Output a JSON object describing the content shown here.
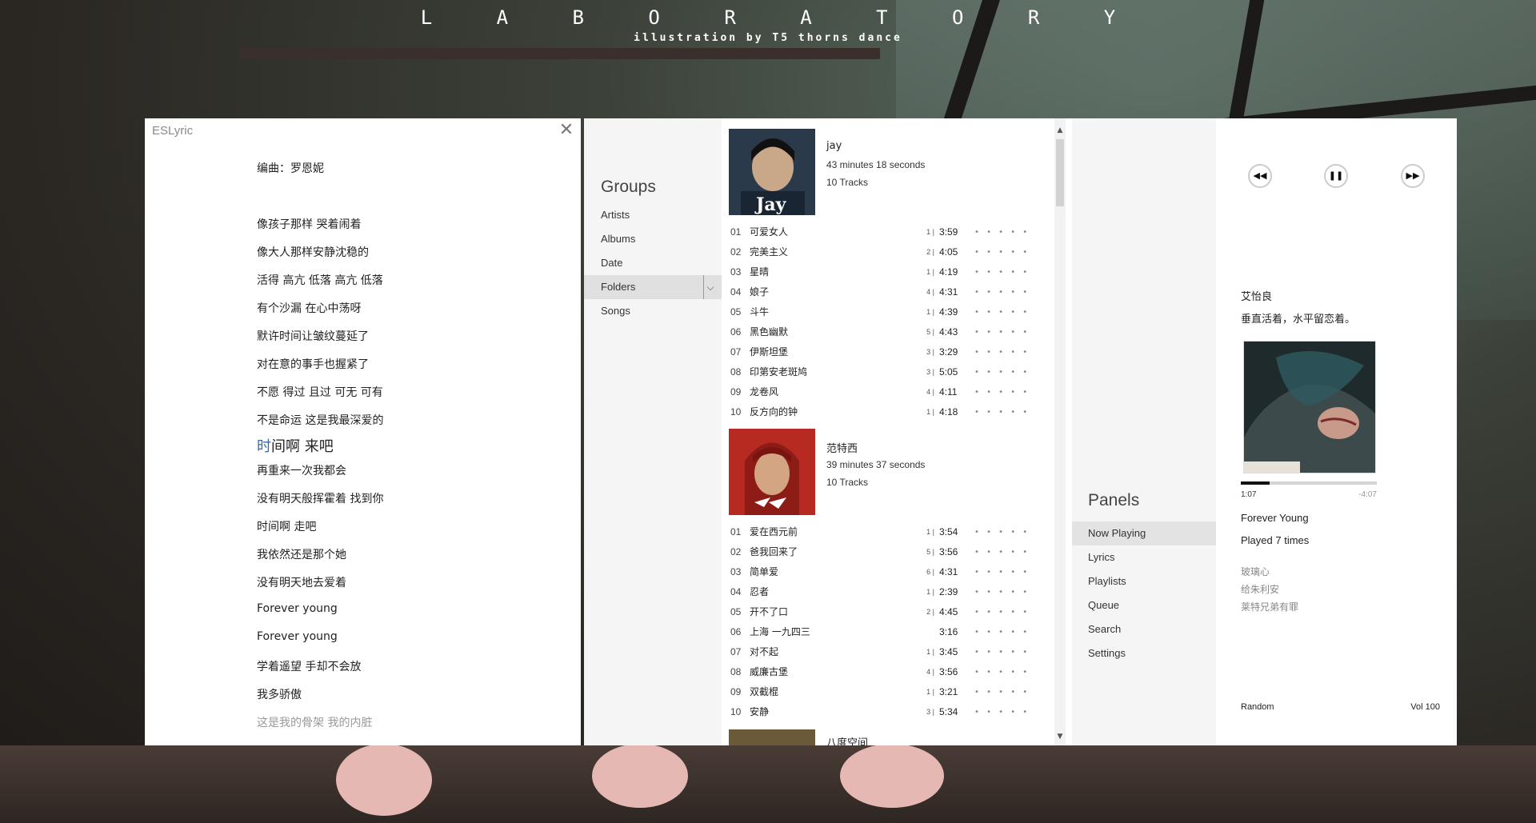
{
  "wallpaper": {
    "title": "L A B O R A T O R Y",
    "subtitle": "illustration by T5 thorns dance"
  },
  "eslyric": {
    "window_title": "ESLyric",
    "close_icon": "close-icon",
    "lines": [
      {
        "text": "编曲：罗恩妮",
        "state": "dim"
      },
      {
        "text": "像孩子那样 哭着闹着",
        "state": "normal"
      },
      {
        "text": "像大人那样安静沈稳的",
        "state": "normal"
      },
      {
        "text": "活得 高亢 低落 高亢 低落",
        "state": "normal"
      },
      {
        "text": "有个沙漏 在心中荡呀",
        "state": "normal"
      },
      {
        "text": "默许时间让皱纹蔓延了",
        "state": "normal"
      },
      {
        "text": "对在意的事手也握紧了",
        "state": "normal"
      },
      {
        "text": "不愿 得过 且过 可无 可有",
        "state": "normal"
      },
      {
        "text": "不是命运 这是我最深爱的",
        "state": "normal"
      },
      {
        "text": "时间啊 来吧",
        "state": "current",
        "highlight": "时",
        "rest": "间啊 来吧"
      },
      {
        "text": "再重来一次我都会",
        "state": "normal"
      },
      {
        "text": "没有明天般挥霍着 找到你",
        "state": "normal"
      },
      {
        "text": "时间啊 走吧",
        "state": "normal"
      },
      {
        "text": "我依然还是那个她",
        "state": "normal"
      },
      {
        "text": "没有明天地去爱着",
        "state": "normal"
      },
      {
        "text": "Forever young",
        "state": "normal"
      },
      {
        "text": "Forever young",
        "state": "normal"
      },
      {
        "text": "学着遥望 手却不会放",
        "state": "normal"
      },
      {
        "text": "我多骄傲",
        "state": "normal"
      },
      {
        "text": "这是我的骨架 我的内脏",
        "state": "dim"
      }
    ]
  },
  "groups": {
    "heading": "Groups",
    "items": [
      {
        "label": "Artists",
        "selected": false
      },
      {
        "label": "Albums",
        "selected": false
      },
      {
        "label": "Date",
        "selected": false
      },
      {
        "label": "Folders",
        "selected": true
      },
      {
        "label": "Songs",
        "selected": false
      }
    ],
    "dropdown_icon": "chevron-down-icon"
  },
  "albums": [
    {
      "name": "jay",
      "duration": "43 minutes 18 seconds",
      "track_count": "10 Tracks",
      "cover_text": "Jay",
      "tracks": [
        {
          "no": "01",
          "title": "可爱女人",
          "disc": "1 |",
          "length": "3:59"
        },
        {
          "no": "02",
          "title": "完美主义",
          "disc": "2 |",
          "length": "4:05"
        },
        {
          "no": "03",
          "title": "星晴",
          "disc": "1 |",
          "length": "4:19"
        },
        {
          "no": "04",
          "title": "娘子",
          "disc": "4 |",
          "length": "4:31"
        },
        {
          "no": "05",
          "title": "斗牛",
          "disc": "1 |",
          "length": "4:39"
        },
        {
          "no": "06",
          "title": "黑色幽默",
          "disc": "5 |",
          "length": "4:43"
        },
        {
          "no": "07",
          "title": "伊斯坦堡",
          "disc": "3 |",
          "length": "3:29"
        },
        {
          "no": "08",
          "title": "印第安老斑鸠",
          "disc": "3 |",
          "length": "5:05"
        },
        {
          "no": "09",
          "title": "龙卷风",
          "disc": "4 |",
          "length": "4:11"
        },
        {
          "no": "10",
          "title": "反方向的钟",
          "disc": "1 |",
          "length": "4:18"
        }
      ]
    },
    {
      "name": "范特西",
      "duration": "39 minutes 37 seconds",
      "track_count": "10 Tracks",
      "cover_text": "",
      "tracks": [
        {
          "no": "01",
          "title": "爱在西元前",
          "disc": "1 |",
          "length": "3:54"
        },
        {
          "no": "02",
          "title": "爸我回来了",
          "disc": "5 |",
          "length": "3:56"
        },
        {
          "no": "03",
          "title": "简单爱",
          "disc": "6 |",
          "length": "4:31"
        },
        {
          "no": "04",
          "title": "忍者",
          "disc": "1 |",
          "length": "2:39"
        },
        {
          "no": "05",
          "title": "开不了口",
          "disc": "2 |",
          "length": "4:45"
        },
        {
          "no": "06",
          "title": "上海 一九四三",
          "disc": "",
          "length": "3:16"
        },
        {
          "no": "07",
          "title": "对不起",
          "disc": "1 |",
          "length": "3:45"
        },
        {
          "no": "08",
          "title": "威廉古堡",
          "disc": "4 |",
          "length": "3:56"
        },
        {
          "no": "09",
          "title": "双截棍",
          "disc": "1 |",
          "length": "3:21"
        },
        {
          "no": "10",
          "title": "安静",
          "disc": "3 |",
          "length": "5:34"
        }
      ]
    },
    {
      "name": "八度空间",
      "duration": "",
      "track_count": "",
      "cover_text": "",
      "tracks": []
    }
  ],
  "rating_dots": "• • • • •",
  "scrollbar": {
    "up": "▲",
    "down": "▼"
  },
  "panels": {
    "heading": "Panels",
    "items": [
      {
        "label": "Now Playing",
        "selected": true
      },
      {
        "label": "Lyrics",
        "selected": false
      },
      {
        "label": "Playlists",
        "selected": false
      },
      {
        "label": "Queue",
        "selected": false
      },
      {
        "label": "Search",
        "selected": false
      },
      {
        "label": "Settings",
        "selected": false
      }
    ]
  },
  "now_playing": {
    "controls": {
      "prev": "◀◀",
      "pause": "❚❚",
      "next": "▶▶"
    },
    "artist": "艾怡良",
    "album": "垂直活着，水平留恋着。",
    "elapsed": "1:07",
    "remaining": "-4:07",
    "progress": 0.21,
    "title": "Forever Young",
    "played": "Played 7 times",
    "related": [
      "玻璃心",
      "给朱利安",
      "莱特兄弟有罪"
    ],
    "mode": "Random",
    "volume": "Vol 100"
  }
}
